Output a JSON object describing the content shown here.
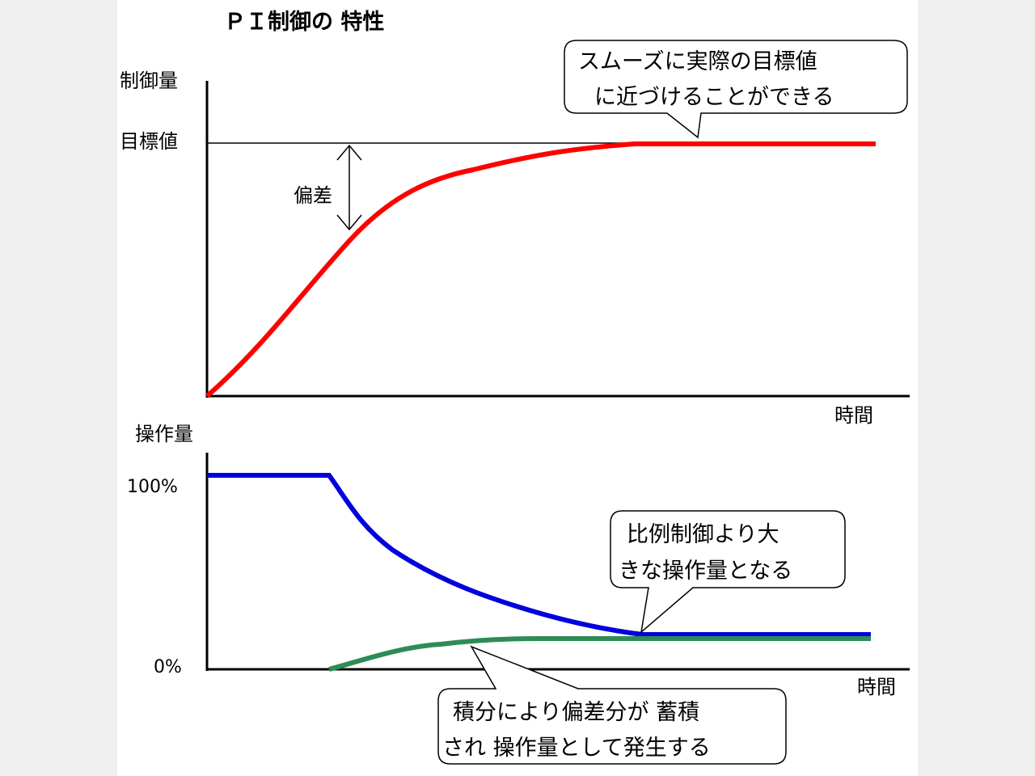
{
  "title": "ＰＩ制御の 特性",
  "top_chart": {
    "y_axis_label": "制御量",
    "setpoint_label": "目標値",
    "x_axis_label": "時間",
    "deviation_label": "偏差",
    "callout_line1": "スムーズに実際の目標値",
    "callout_line2": "に近づけることができる",
    "series_color": "#ff0000"
  },
  "bottom_chart": {
    "y_axis_label": "操作量",
    "tick_100": "100%",
    "tick_0": "0%",
    "x_axis_label": "時間",
    "callout_right_line1": "比例制御より大",
    "callout_right_line2": "きな操作量となる",
    "callout_bottom_line1": "積分により偏差分が 蓄積",
    "callout_bottom_line2": "され 操作量として発生する",
    "blue_color": "#0000dd",
    "green_color": "#2e8b57"
  }
}
